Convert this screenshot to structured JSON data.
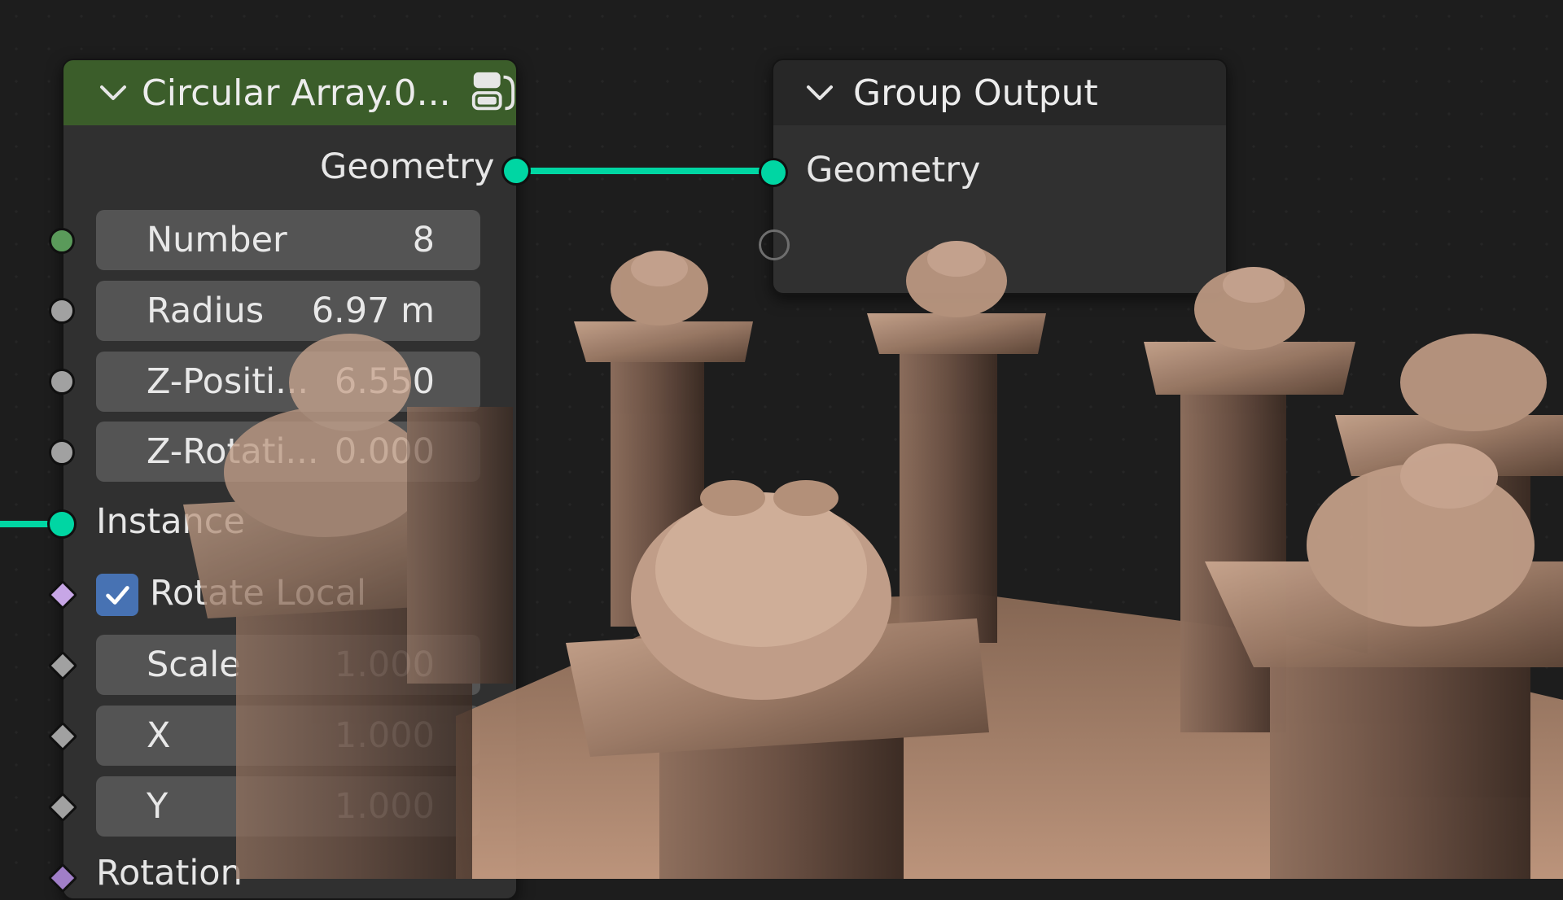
{
  "nodes": {
    "circular_array": {
      "title": "Circular Array.0...",
      "header_color": "#3b5d2a",
      "output_geometry": "Geometry",
      "fields": [
        {
          "label": "Number",
          "value": "8"
        },
        {
          "label": "Radius",
          "value": "6.97 m"
        },
        {
          "label": "Z-Positi...",
          "value": "6.550"
        },
        {
          "label": "Z-Rotati...",
          "value": "0.000"
        }
      ],
      "instance_label": "Instance",
      "rotate_local_label": "Rotate Local",
      "rotate_local_checked": true,
      "scale_fields": [
        {
          "label": "Scale",
          "value": "1.000"
        },
        {
          "label": "X",
          "value": "1.000"
        },
        {
          "label": "Y",
          "value": "1.000"
        }
      ],
      "rotation_label": "Rotation",
      "icon": "node-group-icon"
    },
    "group_output": {
      "title": "Group Output",
      "input_geometry": "Geometry"
    }
  },
  "colors": {
    "geometry_socket": "#00d6a3",
    "integer_socket": "#5a9a5a",
    "float_socket": "#a1a1a1",
    "vector_socket": "#a07ec8",
    "checkbox": "#4772b3"
  }
}
